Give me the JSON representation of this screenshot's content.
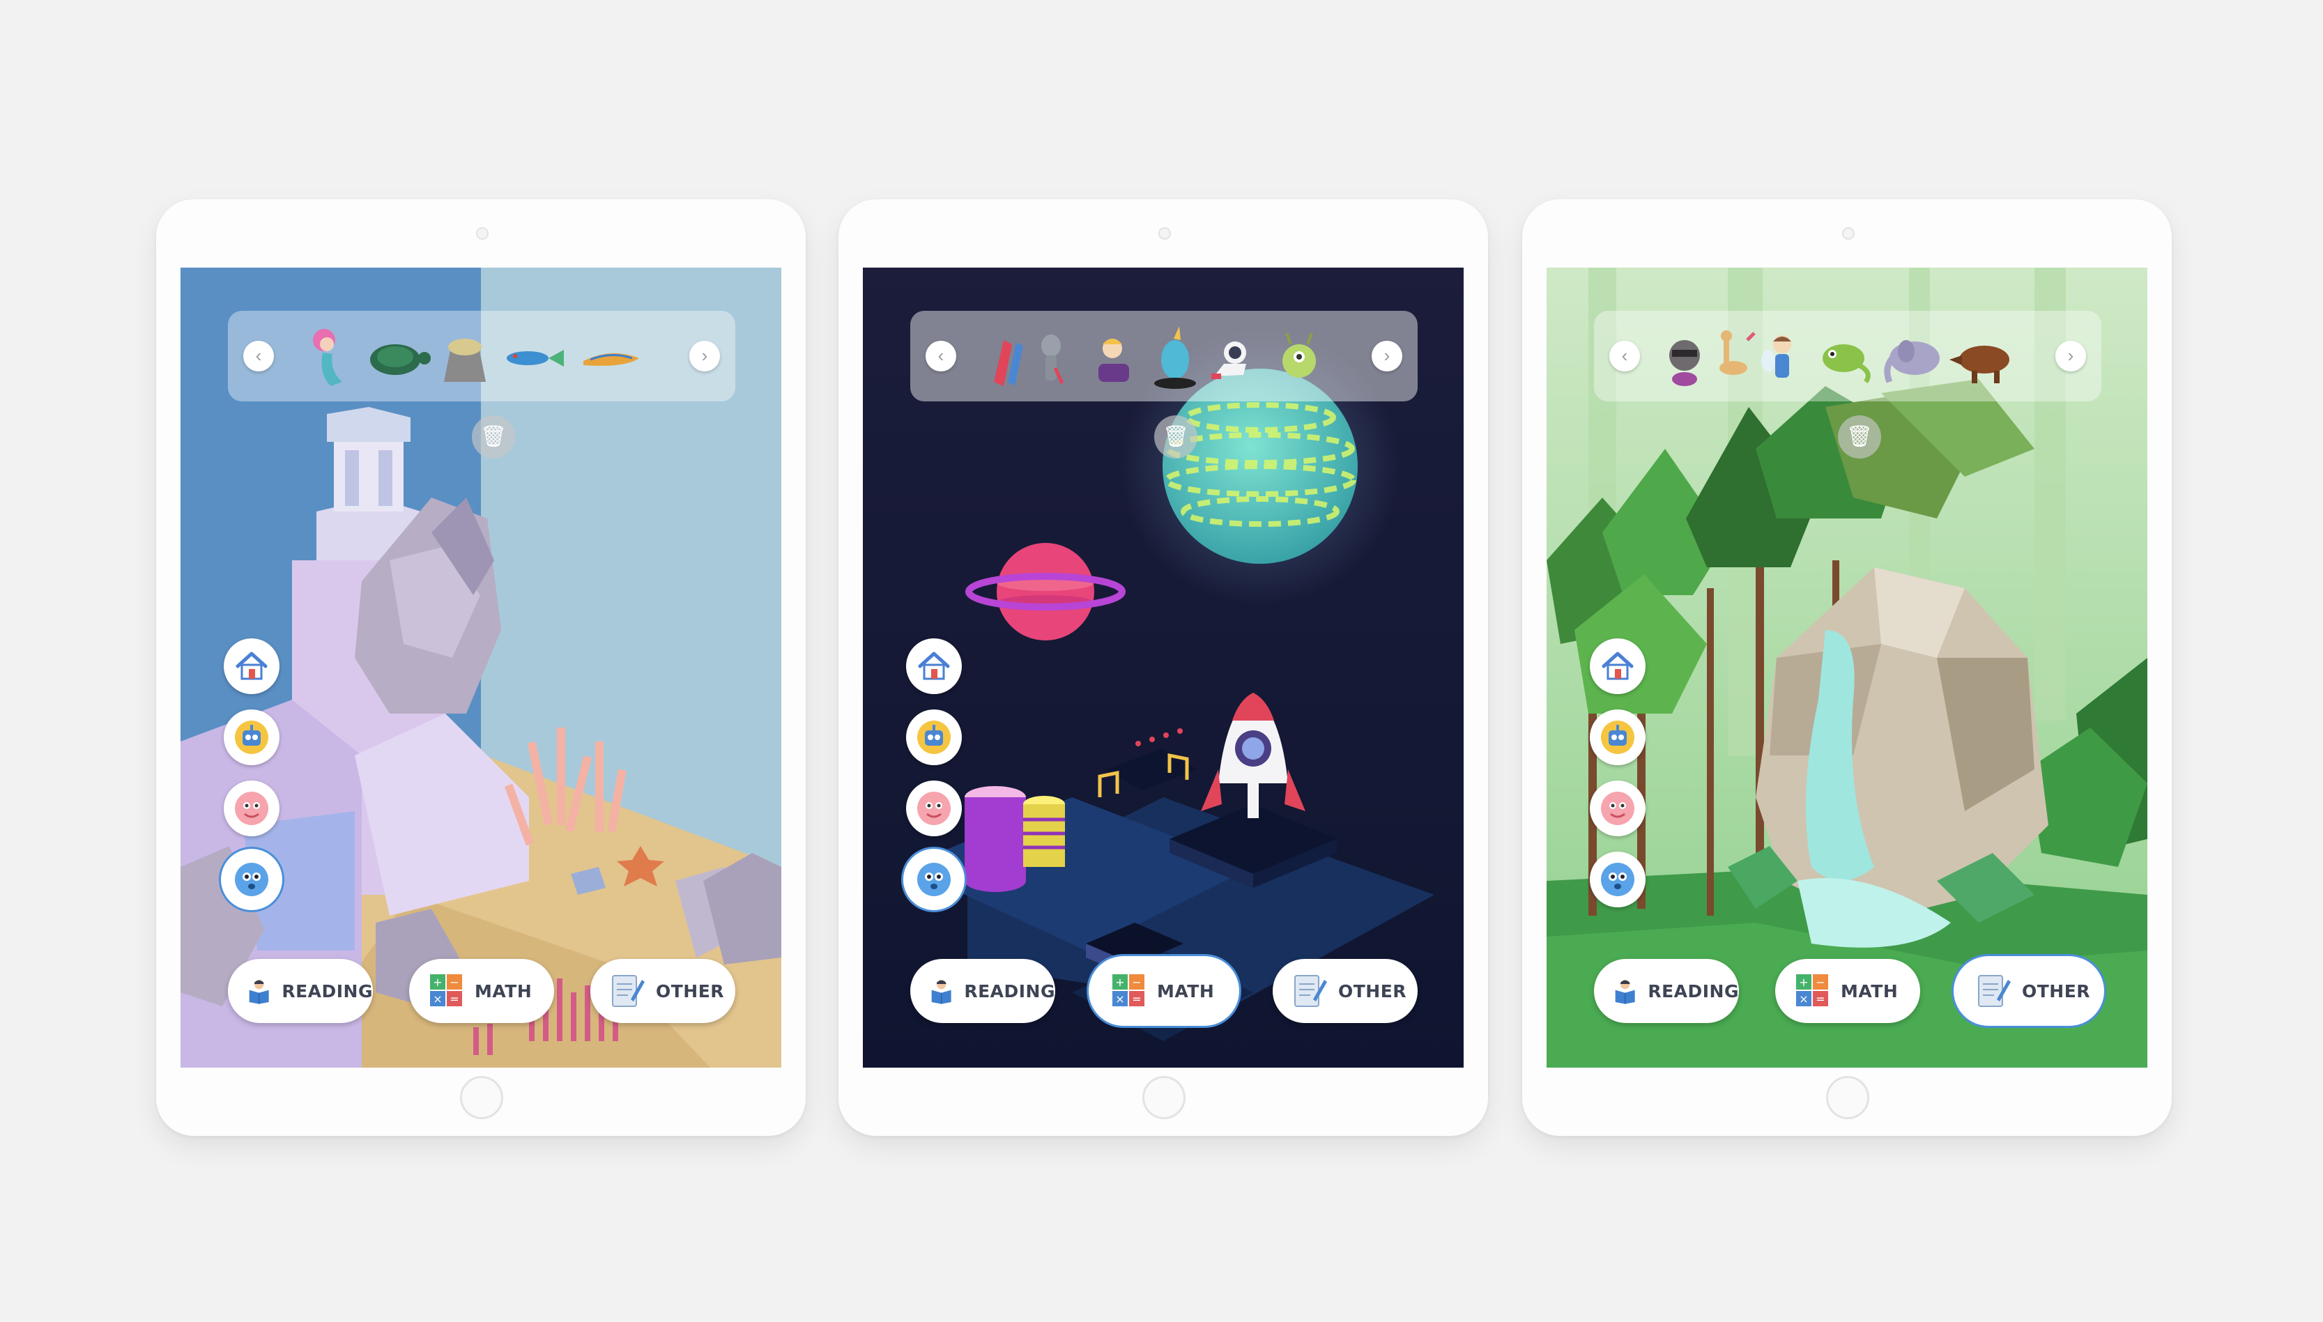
{
  "tablets": [
    {
      "theme": "ocean",
      "stickers": [
        "mermaid-icon",
        "turtle-icon",
        "sea-urchin-icon",
        "fish-icon",
        "eel-icon"
      ],
      "side_nav": [
        "home-icon",
        "robot-yellow-icon",
        "creature-pink-icon",
        "creature-blue-icon"
      ],
      "active_side": "creature-blue-icon",
      "categories": {
        "reading": "READING",
        "math": "MATH",
        "other": "OTHER"
      },
      "active_category": "none"
    },
    {
      "theme": "space",
      "stickers": [
        "rocket-sticker-icon",
        "alien-icon",
        "witch-girl-icon",
        "unicorn-blob-icon",
        "astronaut-icon",
        "alien-planet-icon"
      ],
      "side_nav": [
        "home-icon",
        "robot-yellow-icon",
        "creature-pink-icon",
        "creature-blue-icon"
      ],
      "active_side": "creature-blue-icon",
      "categories": {
        "reading": "READING",
        "math": "MATH",
        "other": "OTHER"
      },
      "active_category": "math"
    },
    {
      "theme": "forest",
      "stickers": [
        "raccoon-icon",
        "deer-icon",
        "fairy-icon",
        "chameleon-icon",
        "elephant-icon",
        "boar-icon"
      ],
      "side_nav": [
        "home-icon",
        "robot-yellow-icon",
        "creature-pink-icon",
        "creature-blue-icon"
      ],
      "active_side": "none",
      "categories": {
        "reading": "READING",
        "math": "MATH",
        "other": "OTHER"
      },
      "active_category": "other"
    }
  ],
  "colors": {
    "accent": "#4a8ed8",
    "label": "#3e4454"
  }
}
